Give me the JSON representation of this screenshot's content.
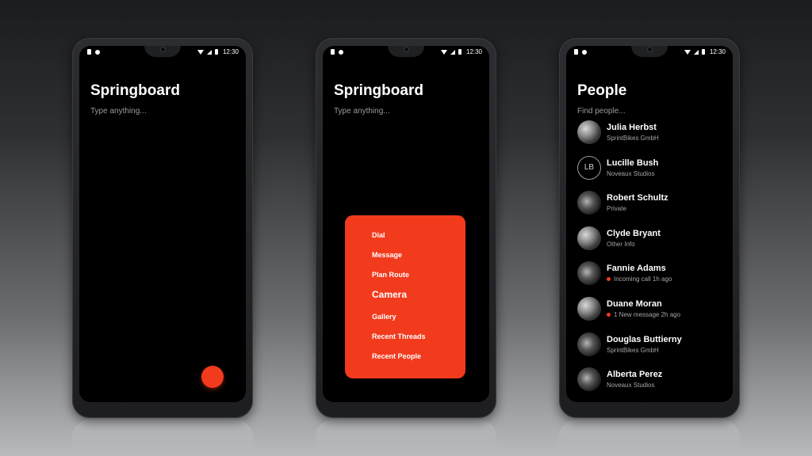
{
  "accent_color": "#f23a1d",
  "status_time": "12:30",
  "screens": {
    "springboard_empty": {
      "title": "Springboard",
      "search_placeholder": "Type anything..."
    },
    "springboard_menu": {
      "title": "Springboard",
      "search_placeholder": "Type anything...",
      "menu_items": [
        "Dial",
        "Message",
        "Plan Route",
        "Camera",
        "Gallery",
        "Recent Threads",
        "Recent People"
      ],
      "highlighted_item": "Camera"
    },
    "people": {
      "title": "People",
      "search_placeholder": "Find people...",
      "contacts": [
        {
          "name": "Julia Herbst",
          "subtitle": "SprintBikes GmbH",
          "avatar": "photo",
          "indicator": false
        },
        {
          "name": "Lucille Bush",
          "subtitle": "Noveaux Studios",
          "avatar": "initials",
          "initials": "LB",
          "indicator": false
        },
        {
          "name": "Robert Schultz",
          "subtitle": "Private",
          "avatar": "photo",
          "indicator": false
        },
        {
          "name": "Clyde Bryant",
          "subtitle": "Other Info",
          "avatar": "photo",
          "indicator": false
        },
        {
          "name": "Fannie Adams",
          "subtitle": "Incoming call 1h ago",
          "avatar": "photo",
          "indicator": true
        },
        {
          "name": "Duane Moran",
          "subtitle": "1 New message 2h ago",
          "avatar": "photo",
          "indicator": true
        },
        {
          "name": "Douglas Buttierny",
          "subtitle": "SprintBikes GmbH",
          "avatar": "photo",
          "indicator": false
        },
        {
          "name": "Alberta Perez",
          "subtitle": "Noveaux Studios",
          "avatar": "photo",
          "indicator": false
        }
      ]
    }
  }
}
